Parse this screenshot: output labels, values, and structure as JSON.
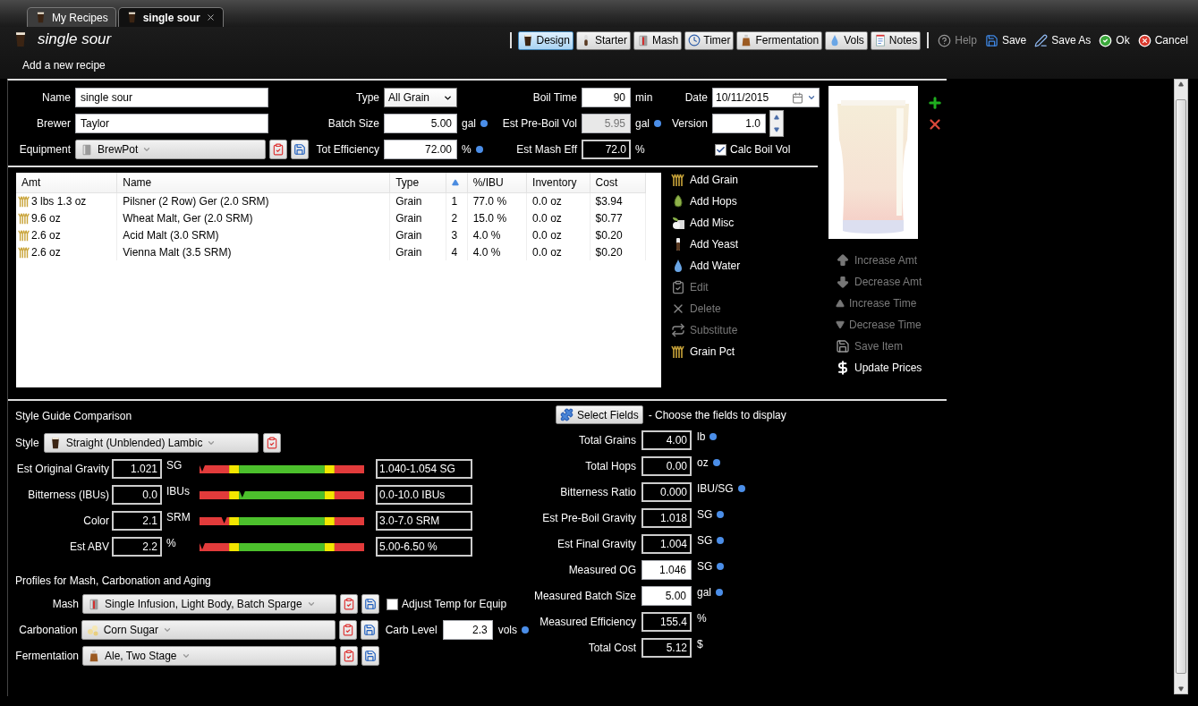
{
  "tabs": [
    {
      "label": "My Recipes",
      "selected": false
    },
    {
      "label": "single sour",
      "selected": true
    }
  ],
  "header": {
    "title": "single sour",
    "subtitle": "Add a new recipe"
  },
  "toolbar": [
    {
      "label": "Design",
      "kind": "toggle",
      "selected": true
    },
    {
      "label": "Starter",
      "kind": "toggle",
      "selected": false
    },
    {
      "label": "Mash",
      "kind": "toggle",
      "selected": false
    },
    {
      "label": "Timer",
      "kind": "toggle",
      "selected": false
    },
    {
      "label": "Fermentation",
      "kind": "toggle",
      "selected": false
    },
    {
      "label": "Vols",
      "kind": "toggle",
      "selected": false
    },
    {
      "label": "Notes",
      "kind": "toggle",
      "selected": false
    },
    {
      "label": "Help",
      "kind": "action",
      "disabled": true
    },
    {
      "label": "Save",
      "kind": "action",
      "disabled": false
    },
    {
      "label": "Save As",
      "kind": "action",
      "disabled": false
    },
    {
      "label": "Ok",
      "kind": "action",
      "disabled": false
    },
    {
      "label": "Cancel",
      "kind": "action",
      "disabled": false
    }
  ],
  "form": {
    "columns": [
      [
        {
          "label": "Name",
          "kind": "text",
          "value": "single sour"
        },
        {
          "label": "Brewer",
          "kind": "text",
          "value": "Taylor"
        },
        {
          "label": "Equipment",
          "kind": "combo",
          "value": "BrewPot"
        }
      ],
      [
        {
          "label": "Type",
          "kind": "select",
          "value": "All Grain"
        },
        {
          "label": "Batch Size",
          "kind": "number",
          "value": "5.00",
          "unit": "gal",
          "dot": true
        },
        {
          "label": "Tot Efficiency",
          "kind": "number",
          "value": "72.00",
          "unit": "%",
          "dot": true
        }
      ],
      [
        {
          "label": "Boil Time",
          "kind": "number",
          "value": "90",
          "unit": "min"
        },
        {
          "label": "Est Pre-Boil Vol",
          "kind": "disabled",
          "value": "5.95",
          "unit": "gal",
          "dot": true
        },
        {
          "label": "Est Mash Eff",
          "kind": "readonly",
          "value": "72.0",
          "unit": "%"
        }
      ],
      [
        {
          "label": "Date",
          "kind": "date",
          "value": "10/11/2015"
        },
        {
          "label": "Version",
          "kind": "spin",
          "value": "1.0"
        },
        {
          "label": "Calc Boil Vol",
          "kind": "checkbox",
          "checked": true
        }
      ]
    ]
  },
  "table": {
    "columns": [
      {
        "label": "Amt"
      },
      {
        "label": "Name"
      },
      {
        "label": "Type"
      },
      {
        "kind": "sort_indicator"
      },
      {
        "label": "%/IBU"
      },
      {
        "label": "Inventory"
      },
      {
        "label": "Cost"
      }
    ],
    "rows": [
      [
        "3 lbs 1.3 oz",
        "Pilsner (2 Row) Ger (2.0 SRM)",
        "Grain",
        "1",
        "77.0 %",
        "0.0 oz",
        "$3.94"
      ],
      [
        "9.6 oz",
        "Wheat Malt, Ger (2.0 SRM)",
        "Grain",
        "2",
        "15.0 %",
        "0.0 oz",
        "$0.77"
      ],
      [
        "2.6 oz",
        "Acid Malt (3.0 SRM)",
        "Grain",
        "3",
        "4.0 %",
        "0.0 oz",
        "$0.20"
      ],
      [
        "2.6 oz",
        "Vienna Malt (3.5 SRM)",
        "Grain",
        "4",
        "4.0 %",
        "0.0 oz",
        "$0.20"
      ]
    ]
  },
  "ingredient_actions": [
    {
      "label": "Add Grain",
      "disabled": false
    },
    {
      "label": "Add Hops",
      "disabled": false
    },
    {
      "label": "Add Misc",
      "disabled": false
    },
    {
      "label": "Add Yeast",
      "disabled": false
    },
    {
      "label": "Add Water",
      "disabled": false
    },
    {
      "label": "Edit",
      "disabled": true
    },
    {
      "label": "Delete",
      "disabled": true
    },
    {
      "label": "Substitute",
      "disabled": true
    },
    {
      "label": "Grain Pct",
      "disabled": false
    }
  ],
  "item_actions": [
    {
      "label": "Increase Amt",
      "disabled": true
    },
    {
      "label": "Decrease Amt",
      "disabled": true
    },
    {
      "label": "Increase Time",
      "disabled": true
    },
    {
      "label": "Decrease Time",
      "disabled": true
    },
    {
      "label": "Save Item",
      "disabled": true
    },
    {
      "label": "Update Prices",
      "disabled": false
    }
  ],
  "style_guide": {
    "title": "Style Guide Comparison",
    "style": {
      "label": "Style",
      "value": "Straight (Unblended) Lambic"
    },
    "rows": [
      {
        "label": "Est Original Gravity",
        "value": "1.021",
        "unit": "SG",
        "level": 0.0,
        "range": "1.040-1.054 SG"
      },
      {
        "label": "Bitterness (IBUs)",
        "value": "0.0",
        "unit": "IBUs",
        "level": 0.26,
        "range": "0.0-10.0 IBUs"
      },
      {
        "label": "Color",
        "value": "2.1",
        "unit": "SRM",
        "level": 0.15,
        "range": "3.0-7.0 SRM"
      },
      {
        "label": "Est ABV",
        "value": "2.2",
        "unit": "%",
        "level": 0.0,
        "range": "5.00-6.50 %"
      }
    ]
  },
  "profiles": {
    "title": "Profiles for Mash, Carbonation and Aging",
    "rows": [
      {
        "label": "Mash",
        "value": "Single Infusion, Light Body, Batch Sparge",
        "extra": {
          "kind": "checkbox",
          "label": "Adjust Temp for Equip",
          "checked": false
        }
      },
      {
        "label": "Carbonation",
        "value": "Corn Sugar",
        "extra": {
          "kind": "field",
          "label": "Carb Level",
          "value": "2.3",
          "unit": "vols",
          "dot": true
        }
      },
      {
        "label": "Fermentation",
        "value": "Ale, Two Stage"
      }
    ]
  },
  "stats": {
    "button": "Select Fields",
    "hint": "- Choose the fields to display",
    "rows": [
      {
        "label": "Total Grains",
        "value": "4.00",
        "unit": "lb",
        "dot": true,
        "kind": "readonly"
      },
      {
        "label": "Total Hops",
        "value": "0.00",
        "unit": "oz",
        "dot": true,
        "kind": "readonly"
      },
      {
        "label": "Bitterness Ratio",
        "value": "0.000",
        "unit": "IBU/SG",
        "dot": true,
        "kind": "readonly"
      },
      {
        "label": "Est Pre-Boil Gravity",
        "value": "1.018",
        "unit": "SG",
        "dot": true,
        "kind": "readonly"
      },
      {
        "label": "Est Final Gravity",
        "value": "1.004",
        "unit": "SG",
        "dot": true,
        "kind": "readonly"
      },
      {
        "label": "Measured OG",
        "value": "1.046",
        "unit": "SG",
        "dot": true,
        "kind": "input"
      },
      {
        "label": "Measured Batch Size",
        "value": "5.00",
        "unit": "gal",
        "dot": true,
        "kind": "input"
      },
      {
        "label": "Measured Efficiency",
        "value": "155.4",
        "unit": "%",
        "kind": "readonly"
      },
      {
        "label": "Total Cost",
        "value": "5.12",
        "unit": "$",
        "kind": "readonly"
      }
    ]
  }
}
